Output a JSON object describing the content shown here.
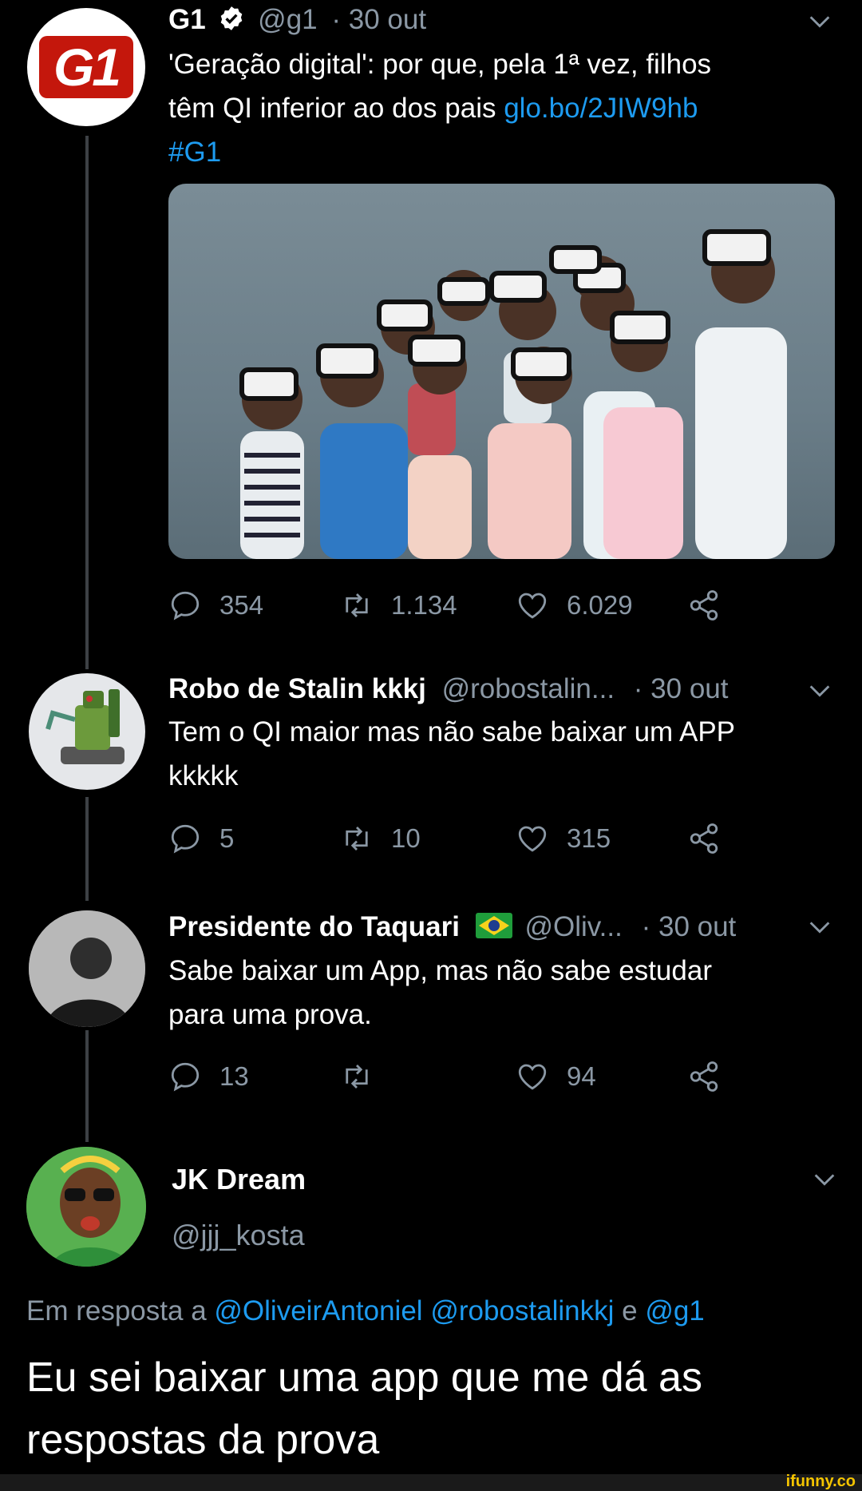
{
  "colors": {
    "background": "#000000",
    "muted": "#8b98a5",
    "link": "#1d9bf0",
    "line": "#3d4145"
  },
  "tweet1": {
    "name": "G1",
    "verified_icon": "verified-badge-icon",
    "handle": "@g1",
    "time": "· 30 out",
    "text_part1": "'Geração digital': por que, pela 1ª vez, filhos",
    "text_part2": "têm QI inferior ao dos pais ",
    "link": "glo.bo/2JIW9hb",
    "hashtag": "#G1",
    "avatar_text": "G1",
    "stats": {
      "replies": "354",
      "retweets": "1.134",
      "likes": "6.029"
    }
  },
  "tweet2": {
    "name": "Robo de Stalin kkkj",
    "handle": "@robostalin...",
    "time": "· 30 out",
    "text_line1": "Tem o QI maior mas não sabe baixar um APP",
    "text_line2": "kkkkk",
    "stats": {
      "replies": "5",
      "retweets": "10",
      "likes": "315"
    }
  },
  "tweet3": {
    "name": "Presidente do Taquari",
    "flag_icon": "brazil-flag-icon",
    "handle": "@Oliv...",
    "time": "· 30 out",
    "text_line1": "Sabe baixar um App, mas não sabe estudar",
    "text_line2": "para uma prova.",
    "stats": {
      "replies": "13",
      "retweets": "",
      "likes": "94"
    }
  },
  "tweet4": {
    "name": "JK Dream",
    "handle": "@jjj_kosta",
    "reply_prefix": "Em resposta a ",
    "mention1": "@OliveirAntoniel",
    "mention2": "@robostalinkkj",
    "reply_conj": " e ",
    "mention3": "@g1",
    "text_line1": "Eu sei baixar uma app que me dá as",
    "text_line2": "respostas da prova"
  },
  "watermark": "ifunny.co"
}
